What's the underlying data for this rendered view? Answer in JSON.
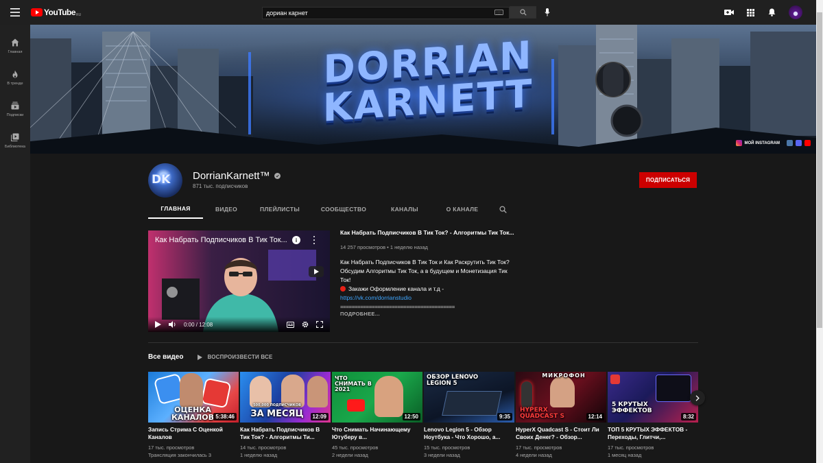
{
  "topbar": {
    "logo_text": "YouTube",
    "logo_region": "RU",
    "search_value": "дориан карнет"
  },
  "sidebar": {
    "items": [
      {
        "label": "Главная",
        "icon": "home-icon"
      },
      {
        "label": "В тренде",
        "icon": "fire-icon"
      },
      {
        "label": "Подписки",
        "icon": "subscriptions-icon"
      },
      {
        "label": "Библиотека",
        "icon": "library-icon"
      }
    ]
  },
  "banner": {
    "title_line1": "DORRIAN",
    "title_line2": "KARNETT",
    "instagram_label": "МОЙ INSTAGRAM"
  },
  "channel": {
    "avatar_text": "DK",
    "name": "DorrianKarnett™",
    "subscribers": "871 тыс. подписчиков",
    "subscribe_label": "ПОДПИСАТЬСЯ",
    "tabs": [
      "ГЛАВНАЯ",
      "ВИДЕО",
      "ПЛЕЙЛИСТЫ",
      "СООБЩЕСТВО",
      "КАНАЛЫ",
      "О КАНАЛЕ"
    ]
  },
  "featured": {
    "player_title": "Как Набрать Подписчиков В Тик Ток...",
    "time": "0:00 / 12:08",
    "title": "Как Набрать Подписчиков В Тик Ток? - Алгоритмы Тик Ток...",
    "meta": "14 257 просмотров • 1 неделю назад",
    "desc_line1": "Как Набрать Подписчиков В Тик Ток и Как Раскрутить Тик Ток?",
    "desc_line2": "Обсудим Алгоритмы Тик Ток, а в будущем и Монетизация Тик Ток!",
    "desc_line3": "Закажи Оформление канала и т.д -",
    "desc_link": "https://vk.com/dorrianstudio",
    "desc_sep": "========================================",
    "more_label": "ПОДРОБНЕЕ..."
  },
  "section": {
    "title": "Все видео",
    "play_all": "ВОСПРОИЗВЕСТИ ВСЕ"
  },
  "videos": [
    {
      "title": "Запись Стрима С Оценкой Каналов",
      "views": "17 тыс. просмотров",
      "date": "Трансляция закончилась 3",
      "duration": "5:38:46",
      "thumb_text": "ОЦЕНКА КАНАЛОВ"
    },
    {
      "title": "Как Набрать Подписчиков В Тик Ток? - Алгоритмы Ти...",
      "views": "14 тыс. просмотров",
      "date": "1 неделю назад",
      "duration": "12:09",
      "thumb_text": "ЗА МЕСЯЦ",
      "thumb_sub": "500.000 ПОДПИСЧИКОВ"
    },
    {
      "title": "Что Снимать Начинающему Ютуберу в...",
      "views": "45 тыс. просмотров",
      "date": "2 недели назад",
      "duration": "12:50",
      "thumb_text": "ЧТО СНИМАТЬ В 2021"
    },
    {
      "title": "Lenovo Legion 5 - Обзор Ноутбука - Что Хорошо, а...",
      "views": "15 тыс. просмотров",
      "date": "3 недели назад",
      "duration": "9:35",
      "thumb_text": "ОБЗОР LENOVO LEGION 5"
    },
    {
      "title": "HyperX Quadcast S - Стоит Ли Своих Денег? - Обзор...",
      "views": "17 тыс. просмотров",
      "date": "4 недели назад",
      "duration": "12:14",
      "thumb_text": "МИКРОФОН",
      "thumb_sub": "HYPERX QUADCAST S"
    },
    {
      "title": "ТОП 5 КРУТЫХ ЭФФЕКТОВ - Переходы, Глитчи,...",
      "views": "17 тыс. просмотров",
      "date": "1 месяц назад",
      "duration": "8:32",
      "thumb_text": "5 КРУТЫХ ЭФФЕКТОВ"
    }
  ],
  "colors": {
    "accent_red": "#cc0000",
    "link_blue": "#3ea6ff",
    "background": "#181818"
  }
}
